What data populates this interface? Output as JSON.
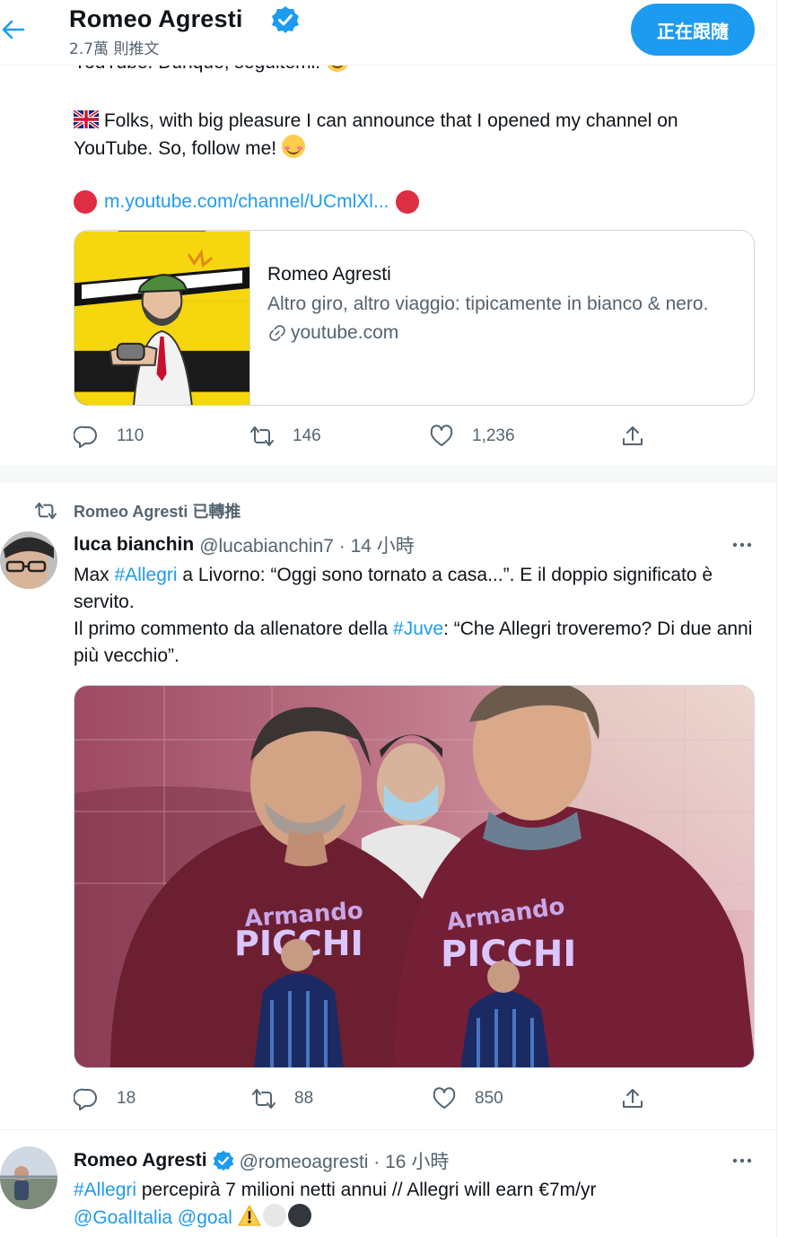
{
  "header": {
    "title": "Romeo Agresti",
    "tweet_count": "2.7萬 則推文",
    "follow_label": "正在跟隨"
  },
  "tweet1": {
    "italian_text_cut": "YouTube. Dunque, seguitemi!",
    "english_text": "Folks, with big pleasure I can announce that I opened my channel on YouTube. So, follow me!",
    "link": "m.youtube.com/channel/UCmlXl...",
    "card": {
      "title": "Romeo Agresti",
      "description": "Altro giro, altro viaggio: tipicamente in bianco & nero.",
      "domain": "youtube.com"
    },
    "replies": "110",
    "retweets": "146",
    "likes": "1,236"
  },
  "tweet2": {
    "retweet_context": "Romeo Agresti 已轉推",
    "author_name": "luca bianchin",
    "author_handle": "@lucabianchin7 · 14 小時",
    "text_a": "Max ",
    "hashtag_1": "#Allegri",
    "text_b": " a Livorno: “Oggi sono tornato a casa...”. E il doppio significato è servito.",
    "text_c": "Il primo commento da allenatore della ",
    "hashtag_2": "#Juve",
    "text_d": ": “Che Allegri troveremo? Di due anni più vecchio”.",
    "shirt_text_1": "Armando",
    "shirt_text_2": "PICCHI",
    "replies": "18",
    "retweets": "88",
    "likes": "850"
  },
  "tweet3": {
    "author_name": "Romeo Agresti",
    "author_handle": "@romeoagresti · 16 小時",
    "hashtag": "#Allegri",
    "text": " percepirà 7 milioni netti annui // Allegri will earn €7m/yr",
    "mention_1": "@GoalItalia",
    "mention_2": "@goal"
  },
  "colors": {
    "accent": "#1d9bf0",
    "text": "#0f1419",
    "muted": "#536471",
    "border": "#cfd9de"
  },
  "icons": [
    "back-arrow-icon",
    "verified-badge-icon",
    "reply-icon",
    "retweet-icon",
    "like-icon",
    "share-icon",
    "more-icon",
    "link-icon"
  ]
}
